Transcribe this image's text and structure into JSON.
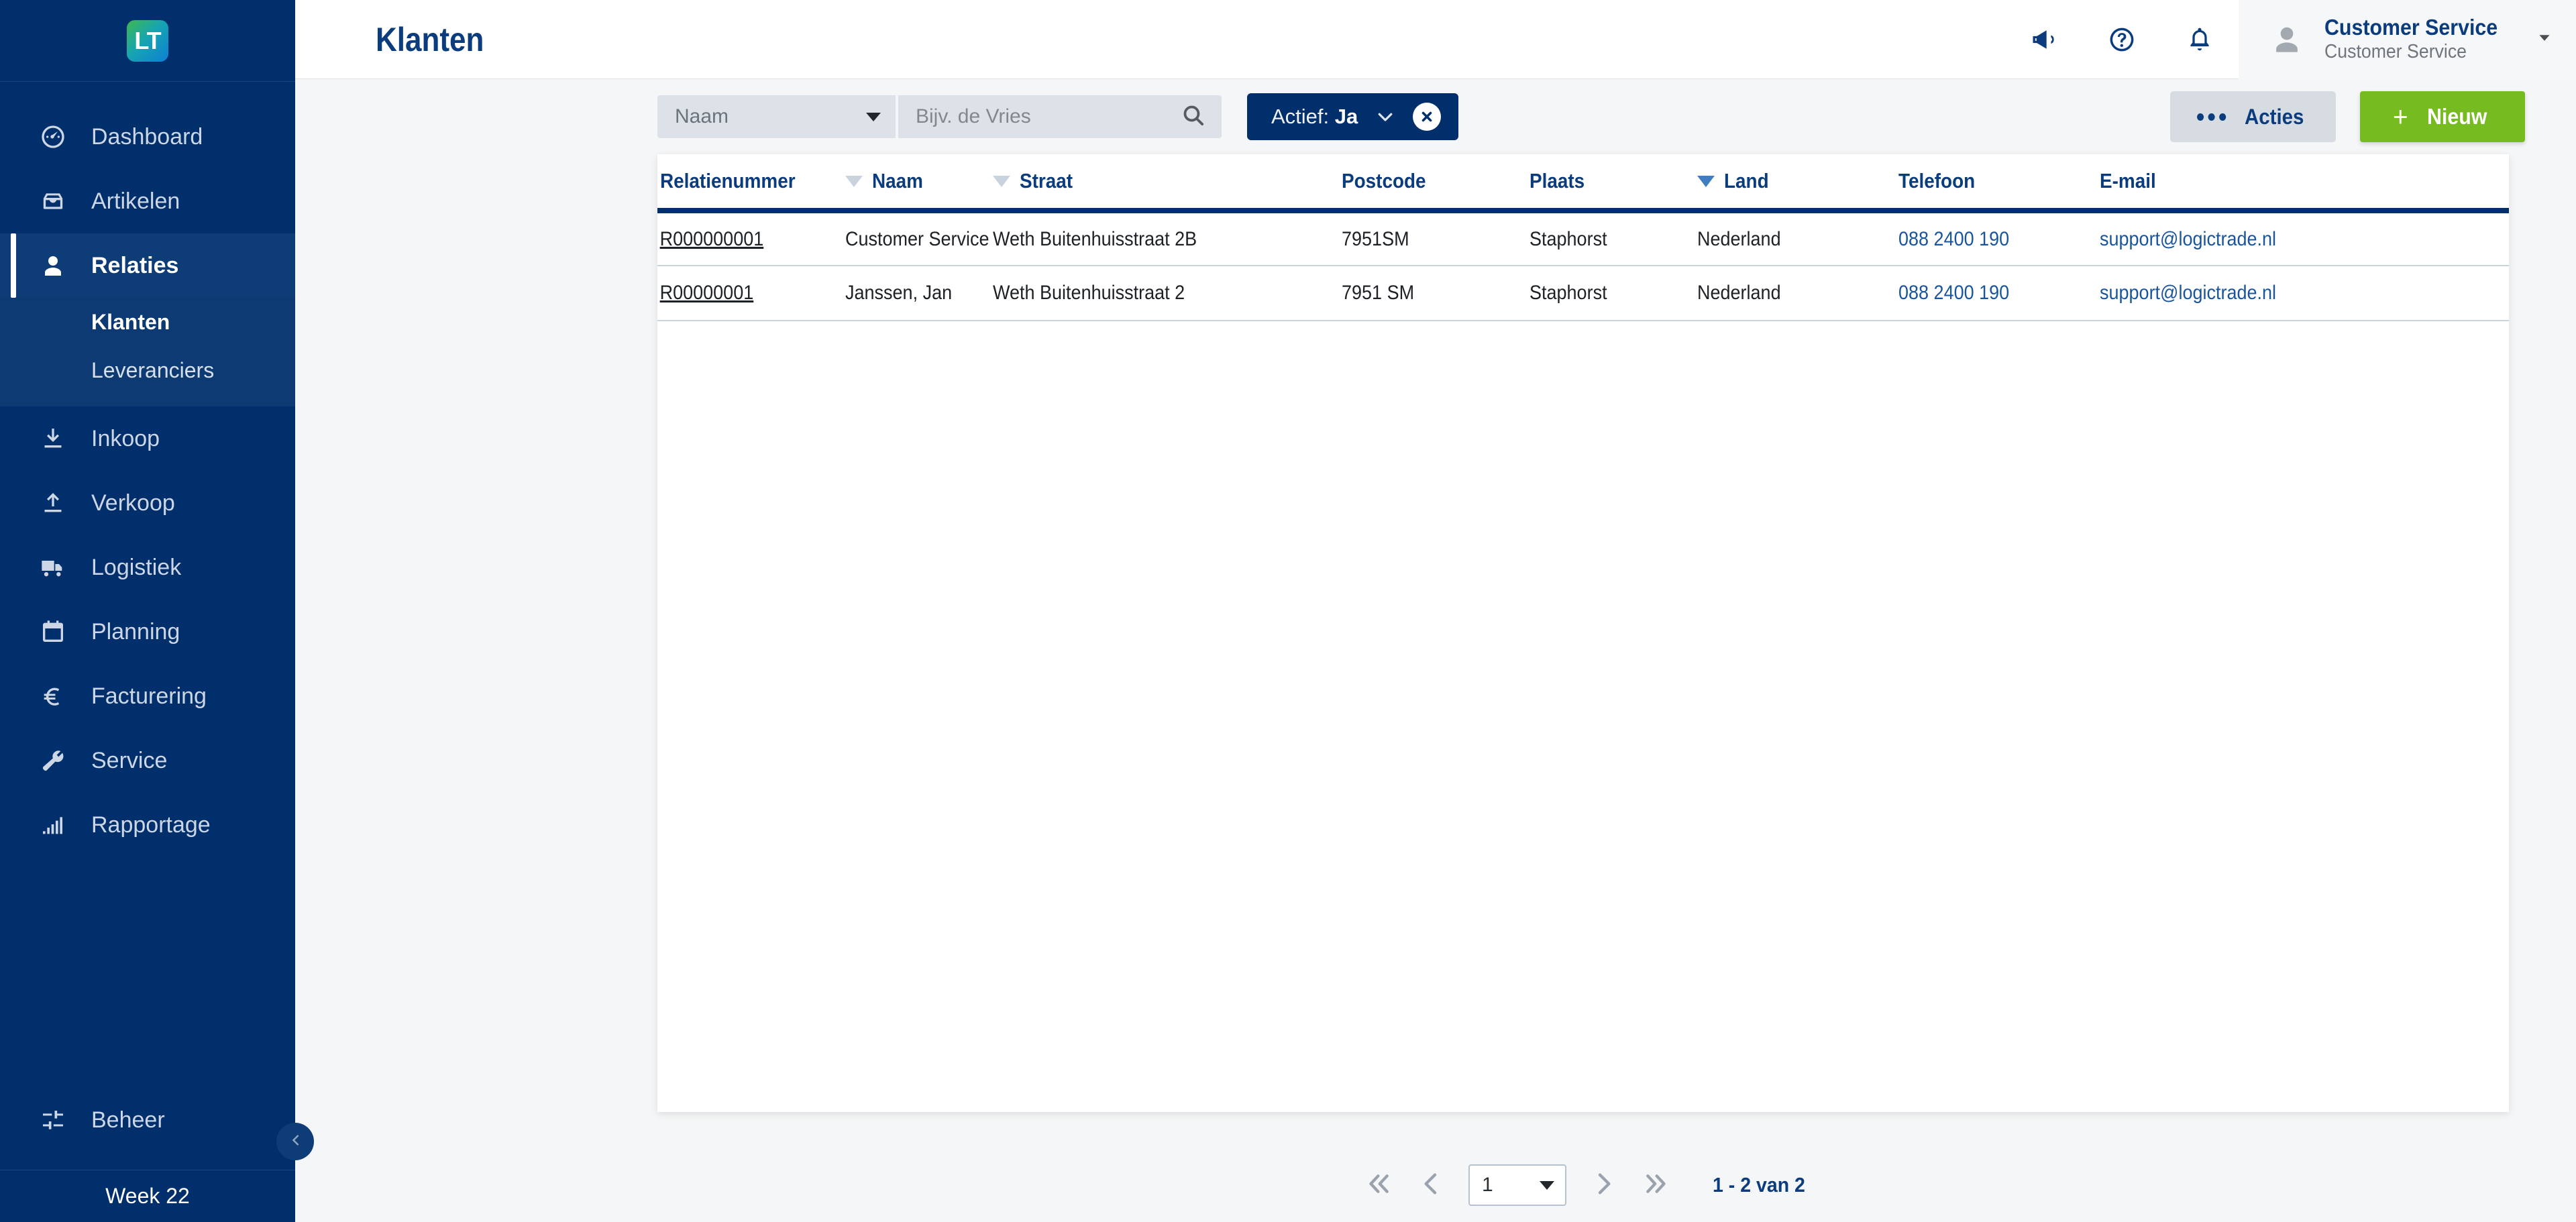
{
  "sidebar": {
    "logo_text": "LT",
    "items": [
      {
        "label": "Dashboard",
        "icon": "speedometer-icon",
        "active": false
      },
      {
        "label": "Artikelen",
        "icon": "inbox-icon",
        "active": false
      },
      {
        "label": "Relaties",
        "icon": "user-icon",
        "active": true
      },
      {
        "label": "Inkoop",
        "icon": "download-icon",
        "active": false
      },
      {
        "label": "Verkoop",
        "icon": "upload-icon",
        "active": false
      },
      {
        "label": "Logistiek",
        "icon": "truck-icon",
        "active": false
      },
      {
        "label": "Planning",
        "icon": "calendar-icon",
        "active": false
      },
      {
        "label": "Facturering",
        "icon": "euro-icon",
        "active": false
      },
      {
        "label": "Service",
        "icon": "wrench-icon",
        "active": false
      },
      {
        "label": "Rapportage",
        "icon": "bar-chart-icon",
        "active": false
      }
    ],
    "subitems": [
      {
        "label": "Klanten",
        "current": true
      },
      {
        "label": "Leveranciers",
        "current": false
      }
    ],
    "admin": {
      "label": "Beheer",
      "icon": "sliders-icon"
    },
    "week_label": "Week 22",
    "collapse_icon": "chevron-left-icon"
  },
  "header": {
    "title": "Klanten",
    "icons": [
      {
        "name": "megaphone-icon"
      },
      {
        "name": "help-circle-icon"
      },
      {
        "name": "bell-icon"
      }
    ],
    "user": {
      "name": "Customer Service",
      "role": "Customer Service",
      "avatar_icon": "user-avatar-icon",
      "caret_icon": "caret-down-icon"
    }
  },
  "toolbar": {
    "field_select": {
      "value": "Naam",
      "caret_icon": "caret-down-icon"
    },
    "search_input": {
      "value": "",
      "placeholder": "Bijv. de Vries"
    },
    "search_button_icon": "search-icon",
    "filter_chip": {
      "prefix": "Actief:",
      "value": "Ja",
      "caret_icon": "chevron-down-icon",
      "close_icon": "close-circle-icon"
    },
    "actions_button": {
      "label": "Acties",
      "icon": "ellipsis-icon"
    },
    "new_button": {
      "label": "Nieuw",
      "icon": "plus-icon"
    }
  },
  "table": {
    "columns": [
      {
        "label": "Relatienummer",
        "filter": "none"
      },
      {
        "label": "Naam",
        "filter": "inactive"
      },
      {
        "label": "Straat",
        "filter": "inactive"
      },
      {
        "label": "Postcode",
        "filter": "none"
      },
      {
        "label": "Plaats",
        "filter": "none"
      },
      {
        "label": "Land",
        "filter": "active"
      },
      {
        "label": "Telefoon",
        "filter": "none"
      },
      {
        "label": "E-mail",
        "filter": "none"
      }
    ],
    "rows": [
      {
        "relatienummer": "R000000001",
        "naam": "Customer Service",
        "straat": "Weth Buitenhuisstraat 2B",
        "postcode": "7951SM",
        "plaats": "Staphorst",
        "land": "Nederland",
        "telefoon": "088 2400 190",
        "email": "support@logictrade.nl"
      },
      {
        "relatienummer": "R00000001",
        "naam": "Janssen, Jan",
        "straat": "Weth Buitenhuisstraat 2",
        "postcode": "7951 SM",
        "plaats": "Staphorst",
        "land": "Nederland",
        "telefoon": "088 2400 190",
        "email": "support@logictrade.nl"
      }
    ]
  },
  "pagination": {
    "first_icon": "chevrons-left-icon",
    "prev_icon": "chevron-left-icon",
    "page_value": "1",
    "next_icon": "chevron-right-icon",
    "last_icon": "chevrons-right-icon",
    "summary": "1 - 2 van 2"
  },
  "colors": {
    "sidebar_bg": "#002f6c",
    "sidebar_active": "#0e3c76",
    "accent_navy": "#0b3c7d",
    "green": "#76bc21",
    "link_blue": "#19559d",
    "chip_bg": "#002f6c"
  }
}
